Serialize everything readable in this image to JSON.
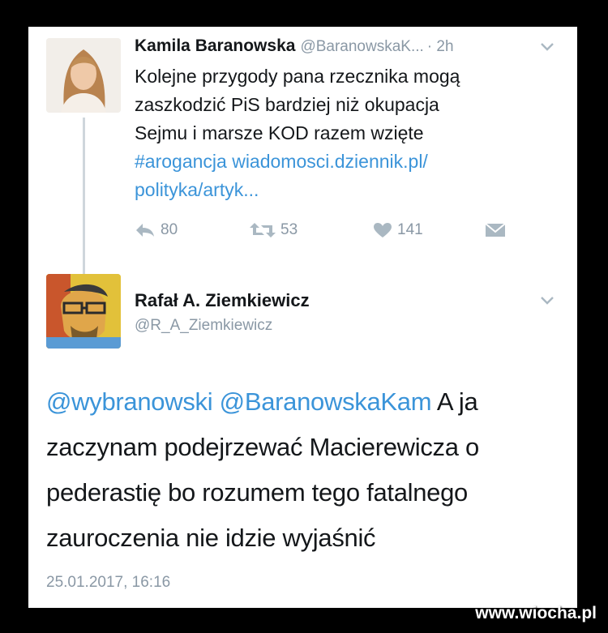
{
  "tweet1": {
    "name": "Kamila Baranowska",
    "handle": "@BaranowskaK...",
    "time": "· 2h",
    "text_line1": "Kolejne przygody pana rzecznika mogą",
    "text_line2": "zaszkodzić PiS bardziej niż okupacja",
    "text_line3": "Sejmu i marsze KOD razem wzięte",
    "hashtag": "#arogancja",
    "link_part1": "wiadomosci.dziennik.pl/",
    "link_part2": "polityka/artyk...",
    "replies": "80",
    "retweets": "53",
    "likes": "141"
  },
  "tweet2": {
    "name": "Rafał A. Ziemkiewicz",
    "handle": "@R_A_Ziemkiewicz",
    "mention1": "@wybranowski",
    "mention2": "@BaranowskaKam",
    "text_after_mentions": "A ja",
    "text_line2": "zaczynam podejrzewać Macierewicza o",
    "text_line3": "pederastię bo rozumem tego fatalnego",
    "text_line4": "zauroczenia nie idzie wyjaśnić",
    "date": "25.01.2017, 16:16"
  },
  "watermark": "www.wiocha.pl",
  "colors": {
    "link": "#3b94d9",
    "muted": "#8a98a5",
    "text": "#14171a"
  },
  "icons": [
    "reply-icon",
    "retweet-icon",
    "heart-icon",
    "direct-message-icon",
    "chevron-down-icon"
  ]
}
